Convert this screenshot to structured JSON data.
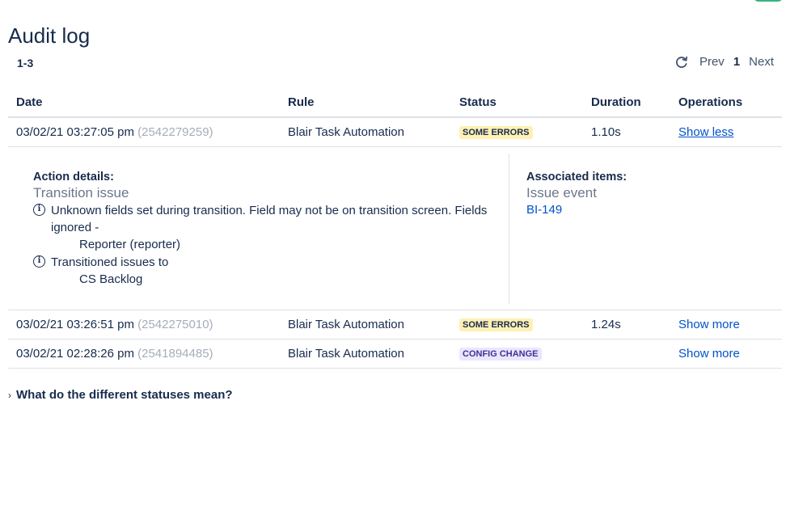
{
  "page": {
    "title": "Audit log",
    "range": "1-3"
  },
  "pager": {
    "refresh_icon": "refresh-icon",
    "prev": "Prev",
    "current": "1",
    "next": "Next"
  },
  "table": {
    "columns": {
      "date": "Date",
      "rule": "Rule",
      "status": "Status",
      "duration": "Duration",
      "operations": "Operations"
    },
    "rows": [
      {
        "date": "03/02/21 03:27:05 pm",
        "id": "(2542279259)",
        "rule": "Blair Task Automation",
        "status": "SOME ERRORS",
        "duration": "1.10s",
        "operation": "Show less"
      },
      {
        "date": "03/02/21 03:26:51 pm",
        "id": "(2542275010)",
        "rule": "Blair Task Automation",
        "status": "SOME ERRORS",
        "duration": "1.24s",
        "operation": "Show more"
      },
      {
        "date": "03/02/21 02:28:26 pm",
        "id": "(2541894485)",
        "rule": "Blair Task Automation",
        "status": "CONFIG CHANGE",
        "duration": "",
        "operation": "Show more"
      }
    ]
  },
  "details": {
    "action_title": "Action details:",
    "action_name": "Transition issue",
    "messages": [
      {
        "text": "Unknown fields set during transition. Field may not be on transition screen. Fields ignored -",
        "detail": "Reporter (reporter)"
      },
      {
        "text": "Transitioned issues to",
        "detail": "CS Backlog"
      }
    ],
    "assoc_title": "Associated items:",
    "assoc_type": "Issue event",
    "assoc_link": "BI-149"
  },
  "faq": {
    "label": "What do the different statuses mean?"
  },
  "colors": {
    "text": "#172b4d",
    "link": "#0052cc",
    "muted": "#a5adba",
    "lozenge_error_bg": "#fff0b3",
    "lozenge_config_bg": "#eae6ff",
    "lozenge_config_text": "#403294",
    "accent_green": "#36b37e"
  }
}
